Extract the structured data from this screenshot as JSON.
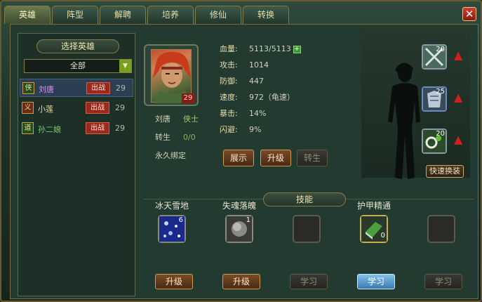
{
  "tabs": [
    "英雄",
    "阵型",
    "解聘",
    "培养",
    "修仙",
    "转换"
  ],
  "active_tab": 0,
  "close_glyph": "✕",
  "left_panel": {
    "title": "选择英雄",
    "filter": "全部",
    "heroes": [
      {
        "badge": "侠",
        "name": "刘唐",
        "status": "出战",
        "level": "29",
        "name_color": "#d890f0",
        "badge_bg": "#2a4a20"
      },
      {
        "badge": "义",
        "name": "小莲",
        "status": "出战",
        "level": "29",
        "name_color": "#e8d8a0",
        "badge_bg": "#6a2a14"
      },
      {
        "badge": "道",
        "name": "孙二娘",
        "status": "出战",
        "level": "29",
        "name_color": "#70d060",
        "badge_bg": "#2a4a20"
      }
    ]
  },
  "hero": {
    "portrait_level": "29",
    "name": "刘唐",
    "class": "侠士",
    "reborn_label": "转生",
    "reborn_value": "0/0",
    "bind_status": "永久绑定"
  },
  "stats": [
    {
      "label": "血量:",
      "value": "5113/5113",
      "plus": true
    },
    {
      "label": "攻击:",
      "value": "1014"
    },
    {
      "label": "防御:",
      "value": "447"
    },
    {
      "label": "速度:",
      "value": "972（龟速）"
    },
    {
      "label": "暴击:",
      "value": "14%"
    },
    {
      "label": "闪避:",
      "value": "9%"
    }
  ],
  "plus_glyph": "+",
  "actions": {
    "show": "展示",
    "upgrade": "升级",
    "reborn": "转生"
  },
  "equipment": [
    {
      "count": "20",
      "icon": "sword-icon"
    },
    {
      "count": "25",
      "icon": "armor-icon"
    },
    {
      "count": "20",
      "icon": "ring-icon"
    }
  ],
  "arrow_glyph": "▲",
  "quick_equip": "快速换装",
  "skills_title": "技能",
  "skills": [
    {
      "name": "冰天雪地",
      "count": "6",
      "button": "升级",
      "state": "upgrade"
    },
    {
      "name": "失魂落魄",
      "count": "1",
      "button": "升级",
      "state": "upgrade"
    },
    {
      "name": "",
      "count": "",
      "button": "学习",
      "state": "disabled"
    },
    {
      "name": "护甲精通",
      "count": "0",
      "button": "学习",
      "state": "learn"
    },
    {
      "name": "",
      "count": "",
      "button": "学习",
      "state": "disabled"
    }
  ]
}
